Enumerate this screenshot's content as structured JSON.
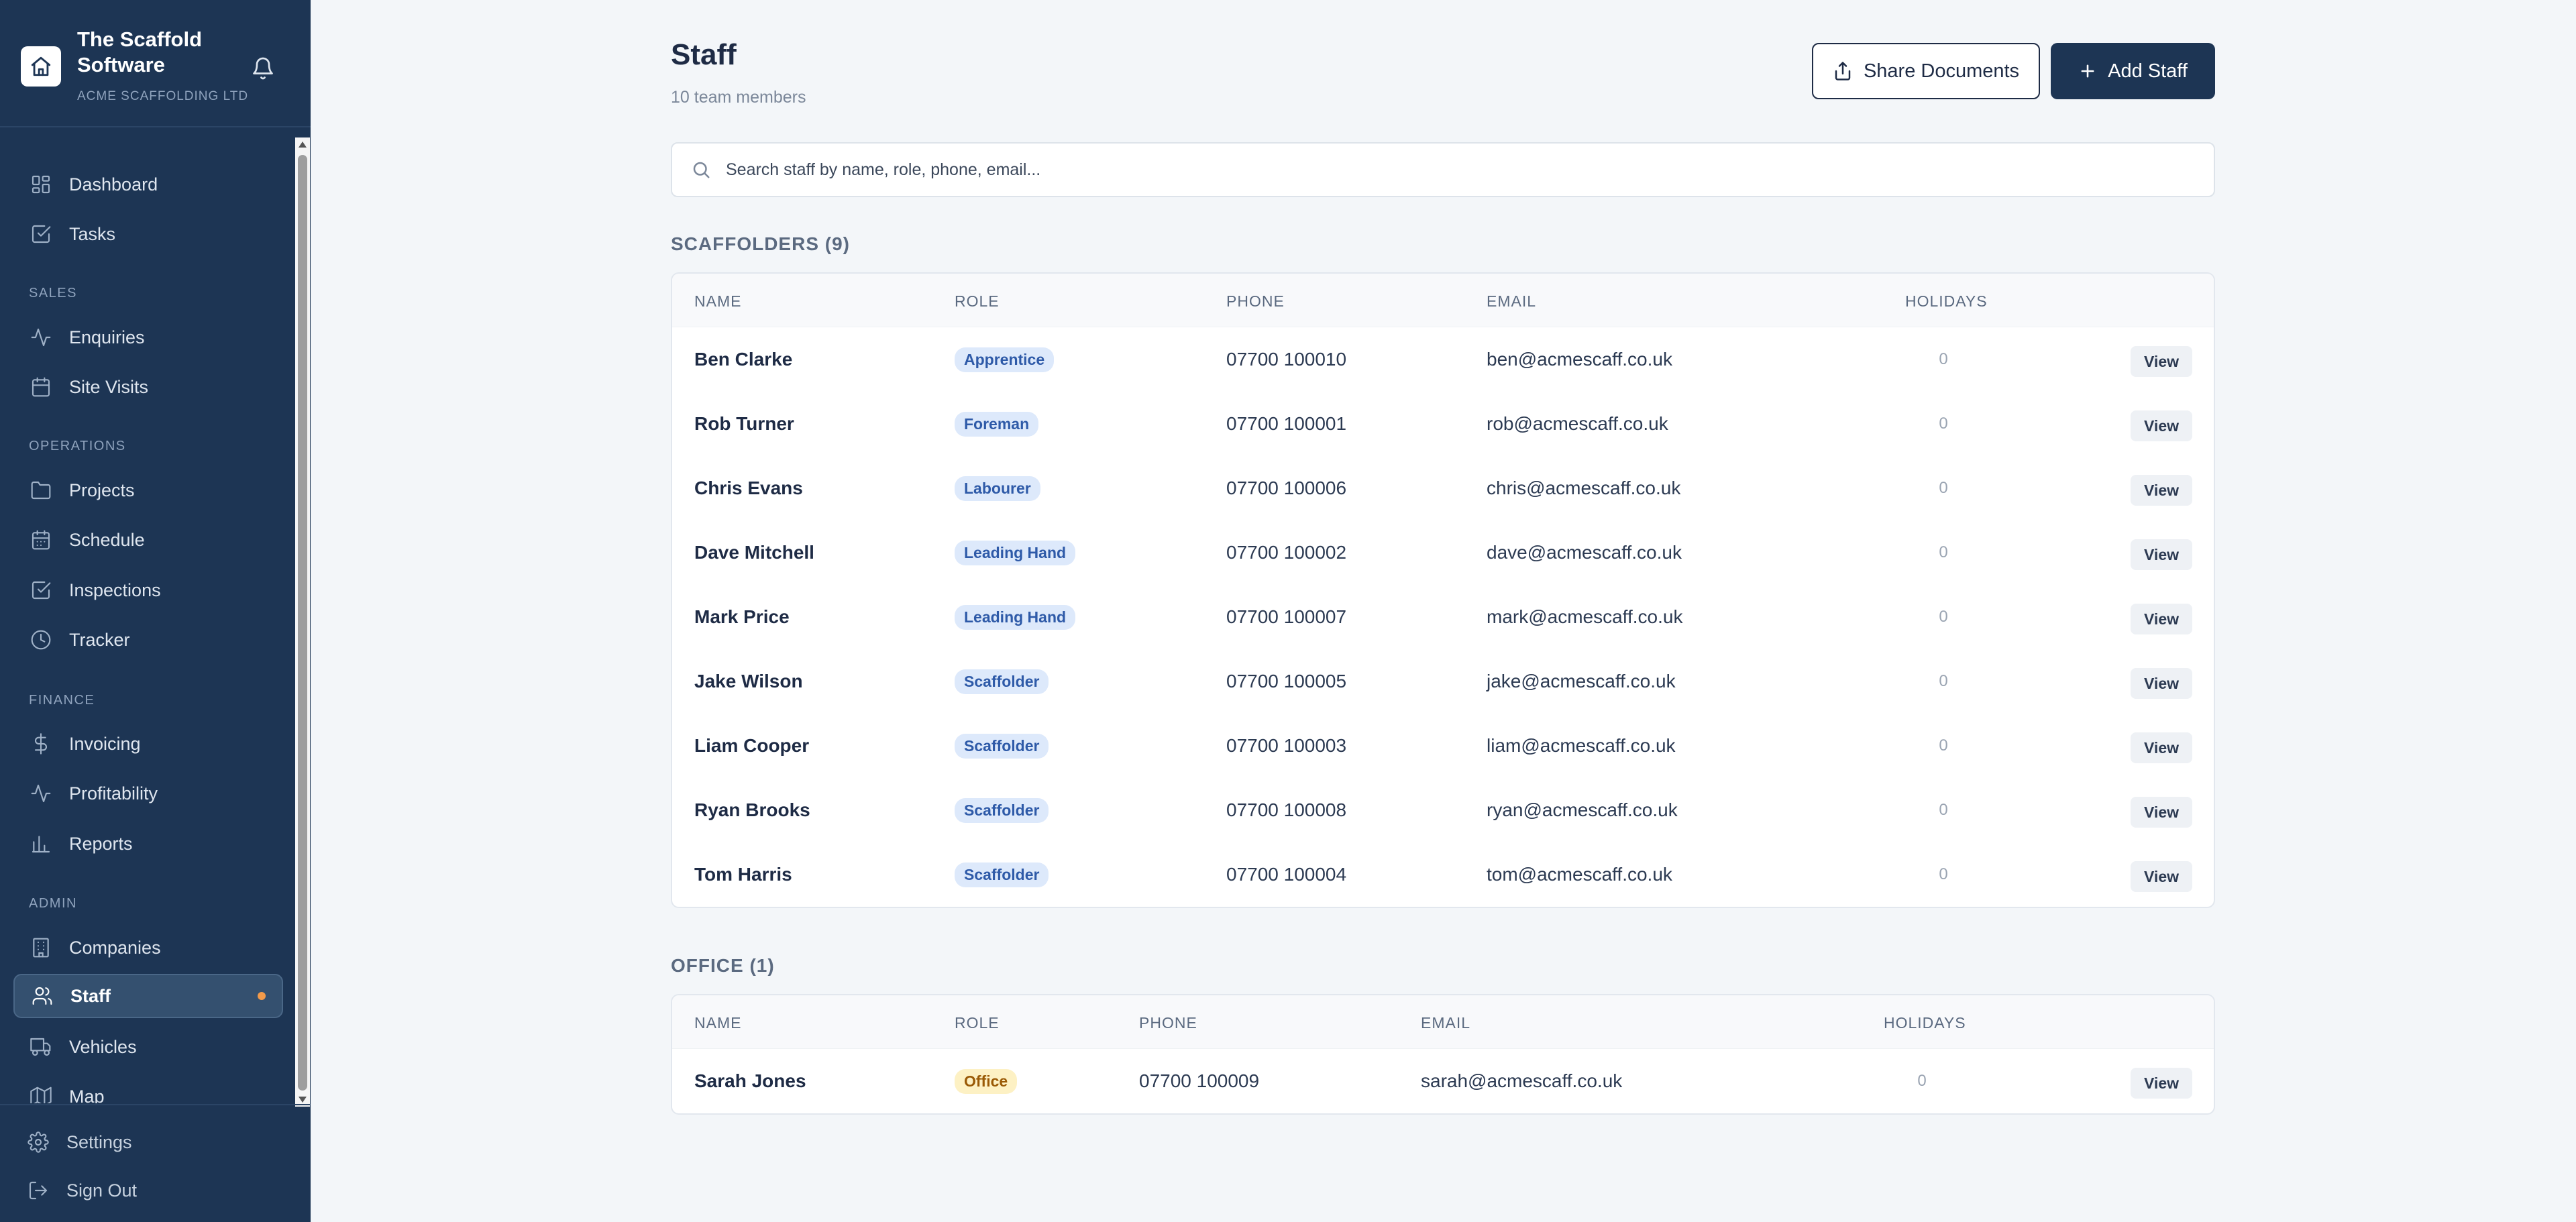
{
  "app": {
    "name": "The Scaffold Software",
    "company": "ACME SCAFFOLDING LTD"
  },
  "sidebar": {
    "items": [
      {
        "label": "Dashboard",
        "icon": "grid-icon"
      },
      {
        "label": "Tasks",
        "icon": "check-square-icon"
      },
      {
        "label": "Enquiries",
        "icon": "activity-icon"
      },
      {
        "label": "Site Visits",
        "icon": "calendar-icon"
      },
      {
        "label": "Projects",
        "icon": "folder-icon"
      },
      {
        "label": "Schedule",
        "icon": "calendar-icon"
      },
      {
        "label": "Inspections",
        "icon": "check-square-icon"
      },
      {
        "label": "Tracker",
        "icon": "clock-icon"
      },
      {
        "label": "Invoicing",
        "icon": "dollar-icon"
      },
      {
        "label": "Profitability",
        "icon": "activity-icon"
      },
      {
        "label": "Reports",
        "icon": "bar-chart-icon"
      },
      {
        "label": "Companies",
        "icon": "building-icon"
      },
      {
        "label": "Staff",
        "icon": "users-icon",
        "active": true
      },
      {
        "label": "Vehicles",
        "icon": "truck-icon"
      },
      {
        "label": "Map",
        "icon": "map-icon"
      }
    ],
    "sections": {
      "sales": "SALES",
      "operations": "OPERATIONS",
      "finance": "FINANCE",
      "admin": "ADMIN"
    },
    "bottom": [
      {
        "label": "Settings",
        "icon": "gear-icon"
      },
      {
        "label": "Sign Out",
        "icon": "log-out-icon"
      }
    ]
  },
  "page": {
    "title": "Staff",
    "subtitle": "10 team members",
    "share_button": "Share Documents",
    "add_button": "Add Staff",
    "search_placeholder": "Search staff by name, role, phone, email..."
  },
  "columns": {
    "name": "NAME",
    "role": "ROLE",
    "phone": "PHONE",
    "email": "EMAIL",
    "holidays": "HOLIDAYS"
  },
  "view_label": "View",
  "groups": {
    "scaffolders": {
      "title": "SCAFFOLDERS (9)",
      "rows": [
        {
          "name": "Ben Clarke",
          "role": "Apprentice",
          "phone": "07700 100010",
          "email": "ben@acmescaff.co.uk",
          "holidays": "0"
        },
        {
          "name": "Rob Turner",
          "role": "Foreman",
          "phone": "07700 100001",
          "email": "rob@acmescaff.co.uk",
          "holidays": "0"
        },
        {
          "name": "Chris Evans",
          "role": "Labourer",
          "phone": "07700 100006",
          "email": "chris@acmescaff.co.uk",
          "holidays": "0"
        },
        {
          "name": "Dave Mitchell",
          "role": "Leading Hand",
          "phone": "07700 100002",
          "email": "dave@acmescaff.co.uk",
          "holidays": "0"
        },
        {
          "name": "Mark Price",
          "role": "Leading Hand",
          "phone": "07700 100007",
          "email": "mark@acmescaff.co.uk",
          "holidays": "0"
        },
        {
          "name": "Jake Wilson",
          "role": "Scaffolder",
          "phone": "07700 100005",
          "email": "jake@acmescaff.co.uk",
          "holidays": "0"
        },
        {
          "name": "Liam Cooper",
          "role": "Scaffolder",
          "phone": "07700 100003",
          "email": "liam@acmescaff.co.uk",
          "holidays": "0"
        },
        {
          "name": "Ryan Brooks",
          "role": "Scaffolder",
          "phone": "07700 100008",
          "email": "ryan@acmescaff.co.uk",
          "holidays": "0"
        },
        {
          "name": "Tom Harris",
          "role": "Scaffolder",
          "phone": "07700 100004",
          "email": "tom@acmescaff.co.uk",
          "holidays": "0"
        }
      ]
    },
    "office": {
      "title": "OFFICE (1)",
      "rows": [
        {
          "name": "Sarah Jones",
          "role": "Office",
          "phone": "07700 100009",
          "email": "sarah@acmescaff.co.uk",
          "holidays": "0"
        }
      ]
    }
  },
  "colors": {
    "sidebar": "#1d3554",
    "accent": "#1d3554",
    "badge_blue_bg": "#dde9fb",
    "badge_blue_text": "#2e5aa8",
    "badge_office_bg": "#fdf1c4",
    "badge_office_text": "#9a5a06",
    "active_dot": "#f29a4a"
  }
}
